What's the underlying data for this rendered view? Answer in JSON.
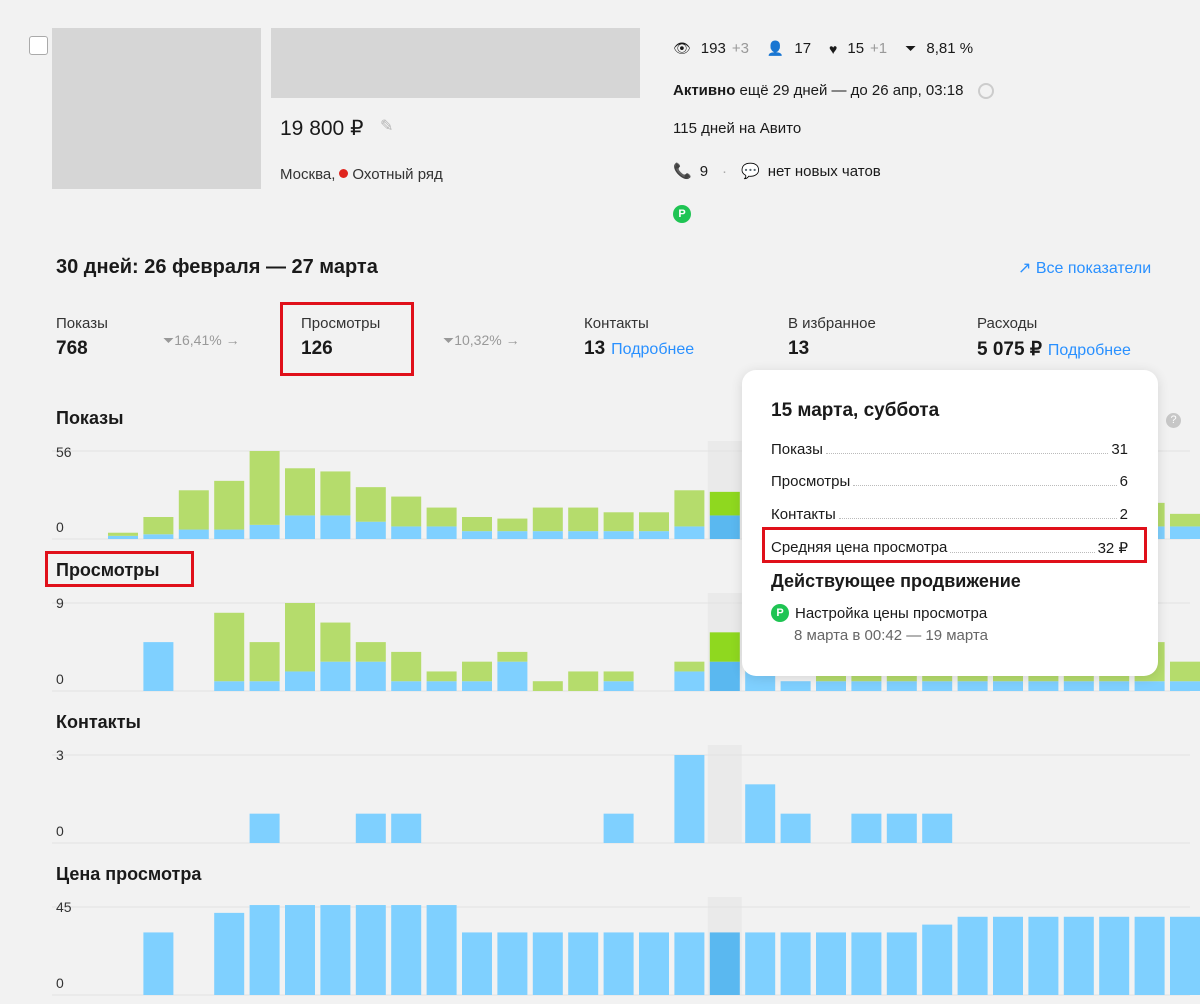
{
  "listing": {
    "price": "19 800 ₽",
    "city": "Москва,",
    "metro": "Охотный ряд",
    "stats": {
      "views": "193",
      "views_delta": "+3",
      "contacts": "17",
      "favorites": "15",
      "favorites_delta": "+1",
      "conversion": "8,81 %"
    },
    "status_word": "Активно",
    "status_rest": "ещё 29 дней — до 26 апр, 03:18",
    "days_on_site": "115 дней на Авито",
    "calls": "9",
    "chats": "нет новых чатов",
    "promo_badge": "P"
  },
  "period": {
    "title": "30 дней: 26 февраля — 27 марта",
    "all_metrics_link": "Все показатели"
  },
  "metrics": [
    {
      "label": "Показы",
      "value": "768"
    },
    {
      "conv": "16,41% →"
    },
    {
      "label": "Просмотры",
      "value": "126"
    },
    {
      "conv": "10,32% →"
    },
    {
      "label": "Контакты",
      "value": "13",
      "link": "Подробнее"
    },
    {
      "label": "В избранное",
      "value": "13"
    },
    {
      "label": "Расходы",
      "value": "5 075 ₽",
      "link": "Подробнее"
    }
  ],
  "tooltip": {
    "date": "15 марта, суббота",
    "rows": [
      {
        "label": "Показы",
        "value": "31"
      },
      {
        "label": "Просмотры",
        "value": "6"
      },
      {
        "label": "Контакты",
        "value": "2"
      },
      {
        "label": "Средняя цена просмотра",
        "value": "32 ₽"
      }
    ],
    "promo_title": "Действующее продвижение",
    "promo_name": "Настройка цены просмотра",
    "promo_dates": "8 марта в 00:42 — 19 марта"
  },
  "colors": {
    "base": "#7fd0ff",
    "promo": "#b5dc6c",
    "highlight": "#eaeaea",
    "accent": "#2990ff",
    "red": "#e0101a"
  },
  "chart_data": [
    {
      "type": "bar",
      "title": "Показы",
      "ylim": [
        0,
        56
      ],
      "stacked": true,
      "series": [
        {
          "values": [
            2,
            3,
            6,
            6,
            9,
            15,
            15,
            11,
            8,
            8,
            5,
            5,
            5,
            5,
            5,
            5,
            8,
            15,
            16,
            18,
            8,
            8,
            8,
            8,
            8,
            8,
            8,
            8,
            8,
            8,
            8
          ]
        },
        {
          "values": [
            2,
            11,
            25,
            31,
            47,
            30,
            28,
            22,
            19,
            12,
            9,
            8,
            15,
            15,
            12,
            12,
            23,
            15,
            18,
            14,
            15,
            15,
            15,
            15,
            15,
            15,
            15,
            15,
            15,
            15,
            8
          ]
        }
      ]
    },
    {
      "type": "bar",
      "title": "Просмотры",
      "ylim": [
        0,
        9
      ],
      "stacked": true,
      "series": [
        {
          "values": [
            0,
            5,
            0,
            1,
            1,
            2,
            3,
            3,
            1,
            1,
            1,
            3,
            0,
            0,
            1,
            0,
            2,
            3,
            2,
            1,
            1,
            1,
            1,
            1,
            1,
            1,
            1,
            1,
            1,
            1,
            1
          ]
        },
        {
          "values": [
            0,
            0,
            0,
            7,
            4,
            7,
            4,
            2,
            3,
            1,
            2,
            1,
            1,
            2,
            1,
            0,
            1,
            3,
            5,
            0,
            5,
            5,
            4,
            4,
            4,
            4,
            4,
            4,
            4,
            4,
            2
          ]
        }
      ]
    },
    {
      "type": "bar",
      "title": "Контакты",
      "ylim": [
        0,
        3
      ],
      "values": [
        0,
        0,
        0,
        0,
        1,
        0,
        0,
        1,
        1,
        0,
        0,
        0,
        0,
        0,
        1,
        0,
        3,
        0,
        2,
        1,
        0,
        1,
        1,
        1,
        0,
        0,
        0,
        0,
        0,
        0,
        0
      ]
    },
    {
      "type": "bar",
      "title": "Цена просмотра",
      "ylim": [
        0,
        45
      ],
      "values": [
        0,
        32,
        0,
        42,
        46,
        46,
        46,
        46,
        46,
        46,
        32,
        32,
        32,
        32,
        32,
        32,
        32,
        32,
        32,
        32,
        32,
        32,
        32,
        36,
        40,
        40,
        40,
        40,
        40,
        40,
        40
      ]
    }
  ]
}
